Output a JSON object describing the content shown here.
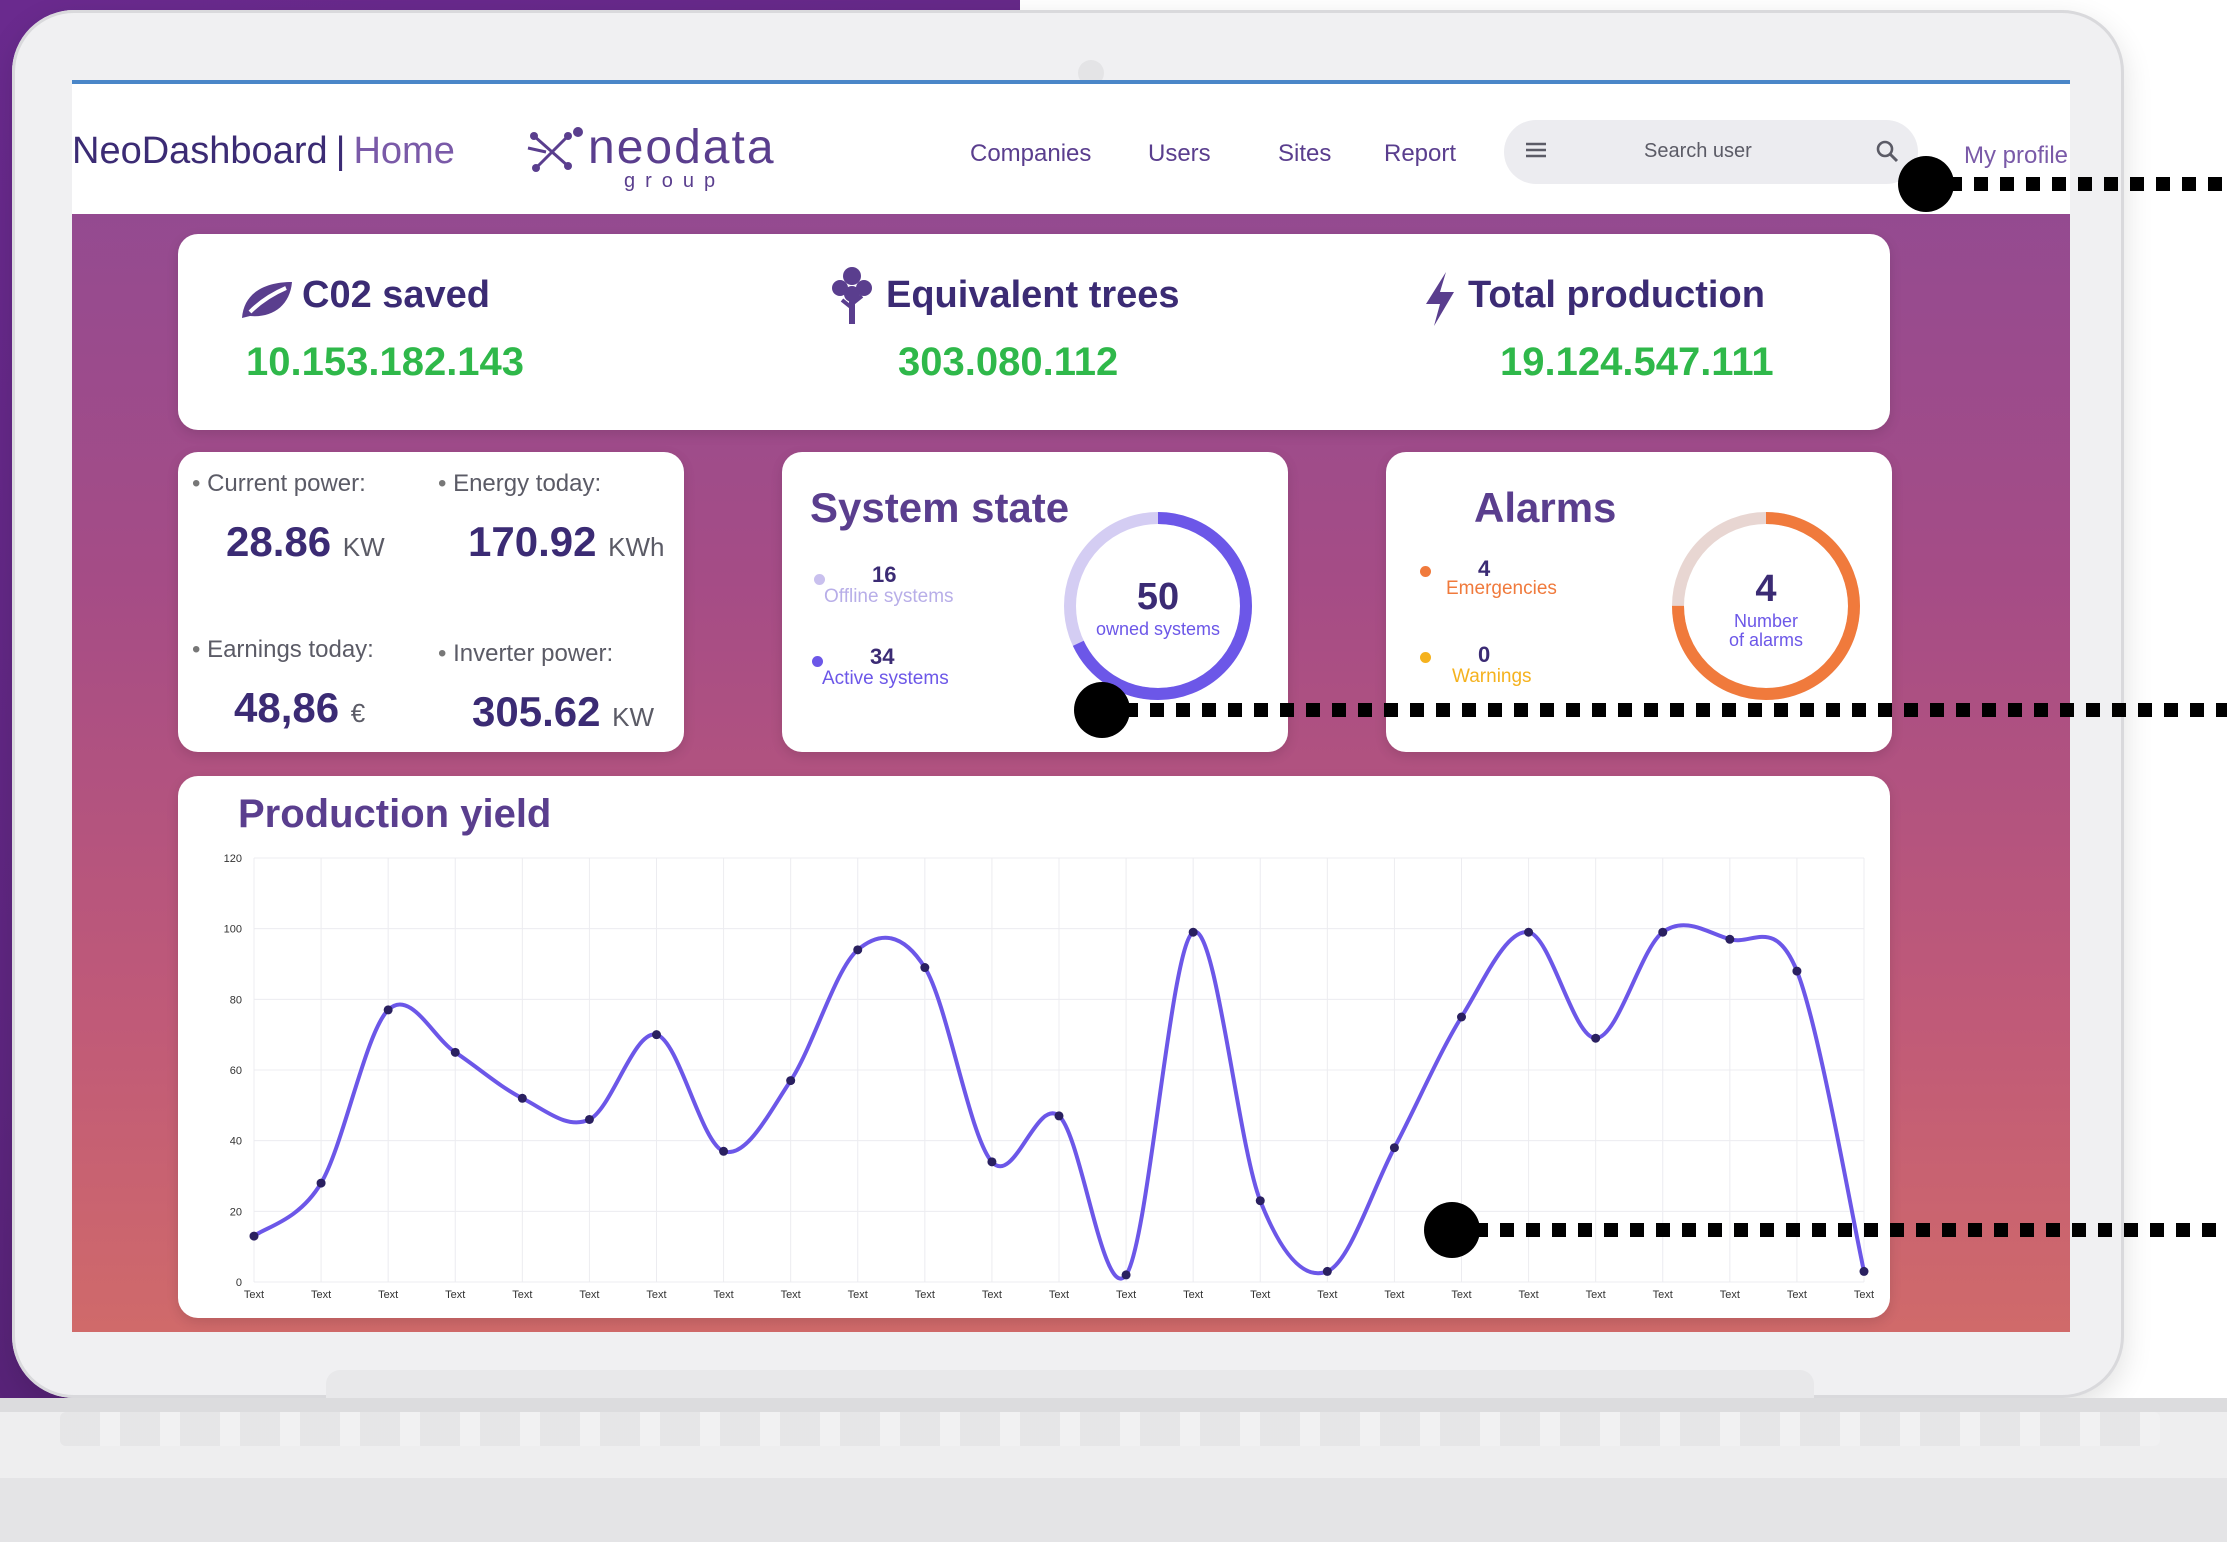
{
  "header": {
    "app_name": "NeoDashboard",
    "separator": "|",
    "page": "Home",
    "logo_text": "neodata",
    "logo_sub": "group",
    "nav": [
      "Companies",
      "Users",
      "Sites",
      "Report"
    ],
    "search_placeholder": "Search user",
    "profile_link": "My profile"
  },
  "kpis": [
    {
      "label": "C02 saved",
      "value": "10.153.182.143",
      "icon": "leaf-icon"
    },
    {
      "label": "Equivalent trees",
      "value": "303.080.112",
      "icon": "tree-icon"
    },
    {
      "label": "Total production",
      "value": "19.124.547.111",
      "icon": "bolt-icon"
    }
  ],
  "stats": {
    "current_power": {
      "label": "Current power:",
      "value": "28.86",
      "unit": "KW"
    },
    "energy_today": {
      "label": "Energy today:",
      "value": "170.92",
      "unit": "KWh"
    },
    "earnings_today": {
      "label": "Earnings today:",
      "value": "48,86",
      "unit": "€"
    },
    "inverter_power": {
      "label": "Inverter power:",
      "value": "305.62",
      "unit": "KW"
    }
  },
  "system_state": {
    "title": "System state",
    "offline": {
      "count": "16",
      "label": "Offline systems"
    },
    "active": {
      "count": "34",
      "label": "Active systems"
    },
    "total": "50",
    "total_label": "owned systems",
    "active_share": 0.68
  },
  "alarms": {
    "title": "Alarms",
    "emergencies": {
      "count": "4",
      "label": "Emergencies"
    },
    "warnings": {
      "count": "0",
      "label": "Warnings"
    },
    "total": "4",
    "total_label_1": "Number",
    "total_label_2": "of alarms",
    "share": 0.75
  },
  "colors": {
    "accent": "#6c57e8",
    "brand": "#3b2b74",
    "green": "#2fb84a",
    "orange": "#f07a3c",
    "yellow": "#f5b21e"
  },
  "chart_data": {
    "type": "line",
    "title": "Production yield",
    "categories": [
      "Text",
      "Text",
      "Text",
      "Text",
      "Text",
      "Text",
      "Text",
      "Text",
      "Text",
      "Text",
      "Text",
      "Text",
      "Text",
      "Text",
      "Text",
      "Text",
      "Text",
      "Text",
      "Text",
      "Text",
      "Text",
      "Text",
      "Text",
      "Text",
      "Text"
    ],
    "values": [
      13,
      28,
      77,
      65,
      52,
      46,
      70,
      37,
      57,
      94,
      89,
      34,
      47,
      2,
      99,
      23,
      3,
      38,
      75,
      99,
      69,
      99,
      97,
      88,
      3
    ],
    "ylim": [
      0,
      120
    ],
    "yticks": [
      0,
      20,
      40,
      60,
      80,
      100,
      120
    ],
    "grid": true,
    "smooth": true
  }
}
